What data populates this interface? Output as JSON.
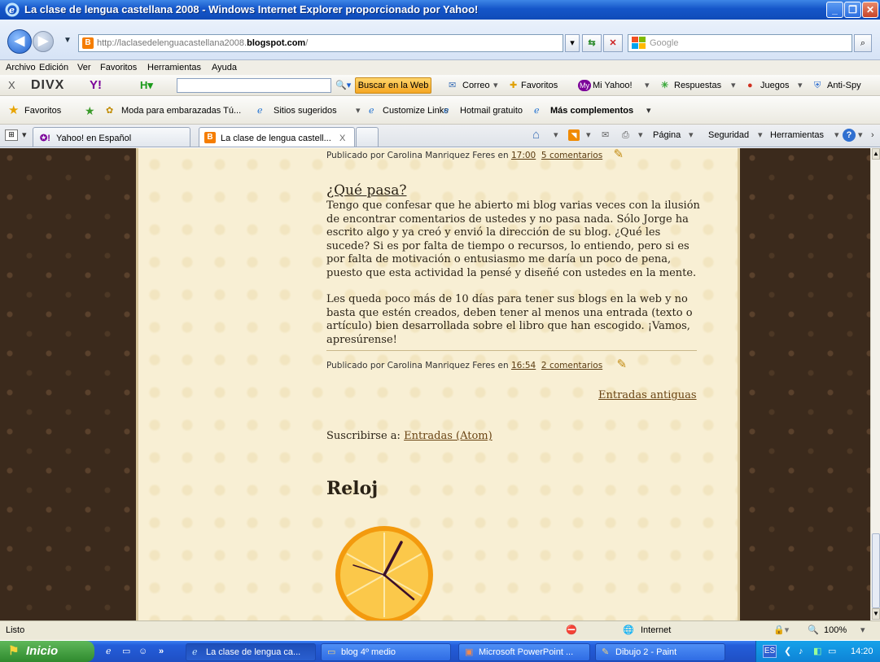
{
  "window": {
    "title": "La clase de lengua castellana 2008 - Windows Internet Explorer proporcionado por Yahoo!"
  },
  "address": {
    "url_prefix": "http://laclasedelenguacastellana2008.",
    "url_domain": "blogspot.com",
    "url_suffix": "/",
    "search_placeholder": "Google"
  },
  "menu": [
    "Archivo",
    "Edición",
    "Ver",
    "Favoritos",
    "Herramientas",
    "Ayuda"
  ],
  "yahoo_toolbar": {
    "close": "X",
    "divx": "DIVX",
    "search_button": "Buscar en la Web",
    "correo": "Correo",
    "favoritos": "Favoritos",
    "mi_yahoo": "Mi Yahoo!",
    "respuestas": "Respuestas",
    "juegos": "Juegos",
    "antispy": "Anti-Spy"
  },
  "favorites_bar": {
    "favoritos": "Favoritos",
    "link1": "Moda para embarazadas Tú...",
    "link2": "Sitios sugeridos",
    "link3": "Customize Links",
    "link4": "Hotmail gratuito",
    "link5": "Más complementos"
  },
  "tabs": {
    "tab1": "Yahoo! en Español",
    "tab2": "La clase de lengua castell...",
    "close": "X"
  },
  "commandbar": {
    "pagina": "Página",
    "seguridad": "Seguridad",
    "herramientas": "Herramientas"
  },
  "blog": {
    "prev_meta": {
      "prefix": "Publicado por Carolina Manriquez Feres en",
      "time": "17:00",
      "comments": "5 comentarios"
    },
    "post": {
      "title": "¿Qué pasa?",
      "para1": "Tengo que confesar que he abierto mi blog varias veces con la ilusión de encontrar comentarios de ustedes y no pasa nada. Sólo Jorge ha escrito algo y ya creó y envió la dirección de su blog. ¿Qué les sucede? Si es por falta de tiempo o recursos, lo entiendo, pero si es por falta de motivación o entusiasmo me daría un poco de pena, puesto que esta actividad la pensé y diseñé con ustedes en la mente.",
      "para2": "Les queda poco más de 10 días para tener sus blogs en la web y no basta que estén creados, deben tener al menos una entrada (texto o artículo) bien desarrollada sobre el libro que han escogido. ¡Vamos, apresúrense!",
      "meta_prefix": "Publicado por Carolina Manriquez Feres en",
      "time": "16:54",
      "comments": "2 comentarios"
    },
    "older": "Entradas antiguas",
    "subscribe_label": "Suscribirse a:",
    "subscribe_link": "Entradas (Atom)",
    "widget_title": "Reloj"
  },
  "status": {
    "text": "Listo",
    "zone": "Internet",
    "zoom": "100%"
  },
  "taskbar": {
    "start": "Inicio",
    "items": [
      "La clase de lengua ca...",
      "blog 4º medio",
      "Microsoft PowerPoint ...",
      "Dibujo 2 - Paint"
    ],
    "lang": "ES",
    "clock": "14:20"
  },
  "colors": {
    "blogspot": "#f57d00",
    "page_bg": "#3b2a1c",
    "column_bg": "#f8efd4",
    "link": "#6a4413"
  }
}
